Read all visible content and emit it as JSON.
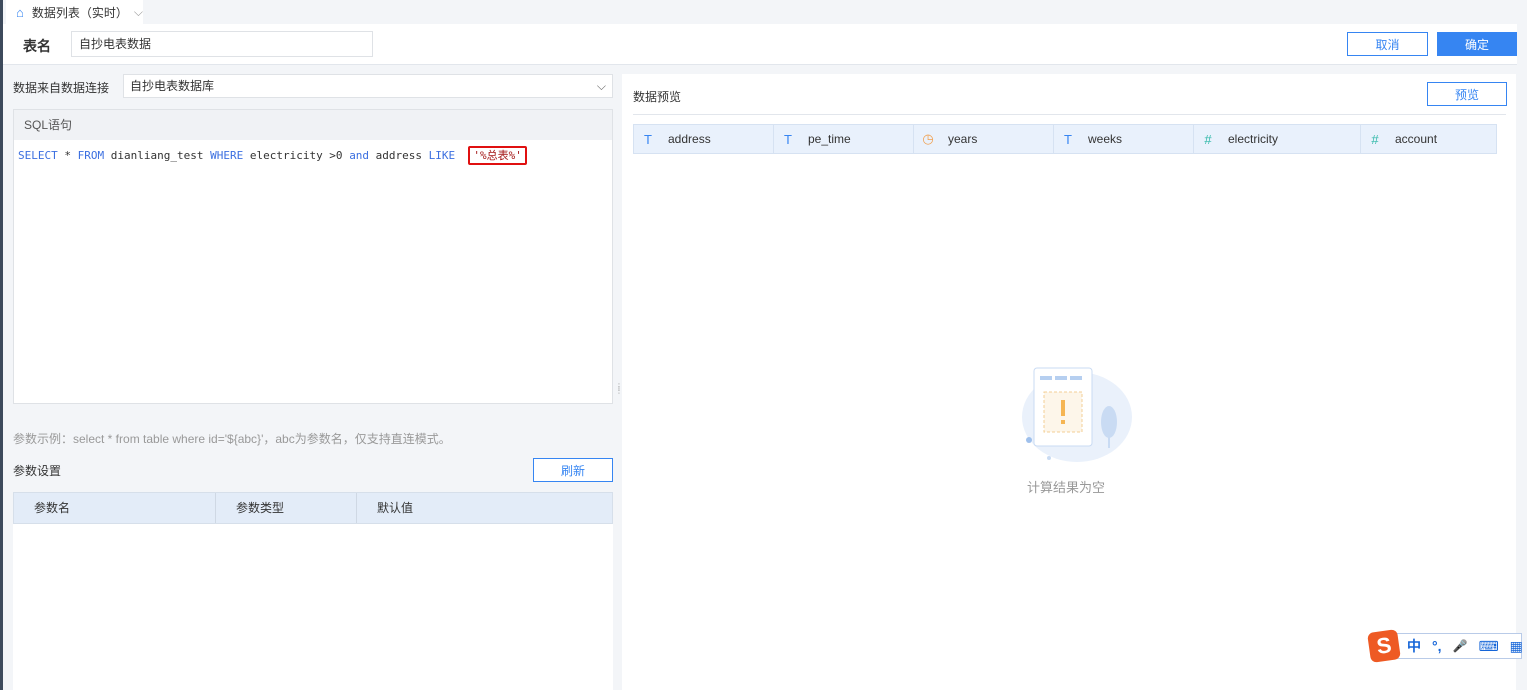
{
  "tab": {
    "title": "数据列表（实时）"
  },
  "header": {
    "table_name_label": "表名",
    "table_name_value": "自抄电表数据",
    "cancel_label": "取消",
    "confirm_label": "确定"
  },
  "source": {
    "label": "数据来自数据连接",
    "selected": "自抄电表数据库"
  },
  "sql": {
    "header": "SQL语句",
    "kw1": "SELECT",
    "p1": " * ",
    "kw2": "FROM",
    "p2": " dianliang_test ",
    "kw3": "WHERE",
    "p3": " electricity >0 ",
    "kw4": "and",
    "p4": " address ",
    "kw5": "LIKE",
    "str": "'%总表%'"
  },
  "params": {
    "hint": "参数示例：select * from table where id='${abc}'，abc为参数名，仅支持直连模式。",
    "label": "参数设置",
    "refresh_label": "刷新",
    "columns": [
      "参数名",
      "参数类型",
      "默认值"
    ]
  },
  "preview": {
    "title": "数据预览",
    "preview_label": "预览",
    "empty_text": "计算结果为空",
    "columns": [
      {
        "name": "address",
        "type": "T",
        "color": "#3685f2"
      },
      {
        "name": "pe_time",
        "type": "T",
        "color": "#3685f2"
      },
      {
        "name": "years",
        "type": "◷",
        "color": "#f0a050"
      },
      {
        "name": "weeks",
        "type": "T",
        "color": "#3685f2"
      },
      {
        "name": "electricity",
        "type": "#",
        "color": "#2fb8a8"
      },
      {
        "name": "account",
        "type": "#",
        "color": "#2fb8a8"
      }
    ]
  },
  "ime": {
    "logo": "S",
    "lang": "中",
    "punct": "°,",
    "mic": "🎤",
    "kbd": "⌨",
    "menu": "▦"
  }
}
